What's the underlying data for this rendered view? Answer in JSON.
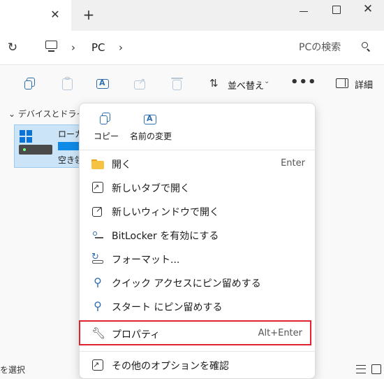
{
  "address": {
    "crumb": "PC",
    "search_placeholder": "PCの検索"
  },
  "commandbar": {
    "sort_label": "並べ替え",
    "more_label": "•••",
    "details_label": "詳細"
  },
  "content": {
    "section_header": "デバイスとドライブ",
    "drive_name": "ローカ",
    "drive_free": "空き領",
    "status_text": "を選択"
  },
  "context_menu": {
    "top_actions": [
      {
        "label": "コピー"
      },
      {
        "label": "名前の変更"
      }
    ],
    "items": [
      {
        "label": "開く",
        "shortcut": "Enter"
      },
      {
        "label": "新しいタブで開く",
        "shortcut": ""
      },
      {
        "label": "新しいウィンドウで開く",
        "shortcut": ""
      },
      {
        "label": "BitLocker を有効にする",
        "shortcut": ""
      },
      {
        "label": "フォーマット...",
        "shortcut": ""
      },
      {
        "label": "クイック アクセスにピン留めする",
        "shortcut": ""
      },
      {
        "label": "スタート にピン留めする",
        "shortcut": ""
      },
      {
        "label": "プロパティ",
        "shortcut": "Alt+Enter"
      },
      {
        "label": "その他のオプションを確認",
        "shortcut": ""
      }
    ]
  },
  "colors": {
    "accent": "#2f6fb0",
    "highlight_border": "#e0232e",
    "selection": "#cce4f7"
  }
}
